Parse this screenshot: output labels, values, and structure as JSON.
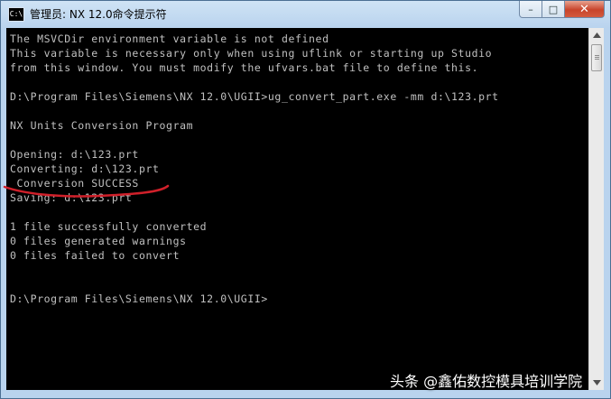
{
  "window": {
    "title": "管理员: NX 12.0命令提示符",
    "icon_label": "C:\\",
    "buttons": {
      "minimize": "–",
      "maximize": "□",
      "close": "✕"
    }
  },
  "console": {
    "text_color": "#c0c0c0",
    "background": "#000000",
    "lines": [
      "The MSVCDir environment variable is not defined",
      "This variable is necessary only when using uflink or starting up Studio",
      "from this window. You must modify the ufvars.bat file to define this.",
      "",
      "D:\\Program Files\\Siemens\\NX 12.0\\UGII>ug_convert_part.exe -mm d:\\123.prt",
      "",
      "NX Units Conversion Program",
      "",
      "Opening: d:\\123.prt",
      "Converting: d:\\123.prt",
      " Conversion SUCCESS",
      "Saving: d:\\123.prt",
      "",
      "1 file successfully converted",
      "0 files generated warnings",
      "0 files failed to convert",
      "",
      "",
      "D:\\Program Files\\Siemens\\NX 12.0\\UGII>"
    ]
  },
  "annotation": {
    "color": "#d0202a"
  },
  "watermark": "头条 @鑫佑数控模具培训学院"
}
